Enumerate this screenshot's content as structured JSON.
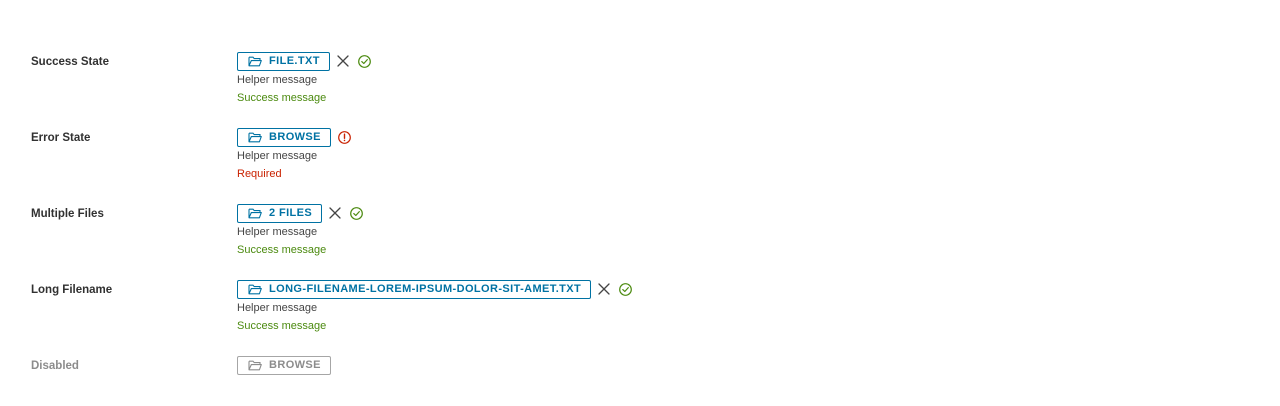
{
  "colors": {
    "primary": "#0072a3",
    "success": "#4b8a0f",
    "error": "#c92100",
    "disabled": "#8c8c8c",
    "text": "#313131"
  },
  "rows": [
    {
      "label": "Success State",
      "button_label": "FILE.TXT",
      "helper": "Helper message",
      "status_message": "Success message",
      "status": "success",
      "icons": [
        "folder-icon",
        "close-icon",
        "check-circle-icon"
      ]
    },
    {
      "label": "Error State",
      "button_label": "BROWSE",
      "helper": "Helper message",
      "status_message": "Required",
      "status": "error",
      "icons": [
        "folder-icon",
        "exclamation-circle-icon"
      ]
    },
    {
      "label": "Multiple Files",
      "button_label": "2 FILES",
      "helper": "Helper message",
      "status_message": "Success message",
      "status": "success",
      "icons": [
        "folder-icon",
        "close-icon",
        "check-circle-icon"
      ]
    },
    {
      "label": "Long Filename",
      "button_label": "LONG-FILENAME-LOREM-IPSUM-DOLOR-SIT-AMET.TXT",
      "helper": "Helper message",
      "status_message": "Success message",
      "status": "success",
      "icons": [
        "folder-icon",
        "close-icon",
        "check-circle-icon"
      ]
    },
    {
      "label": "Disabled",
      "button_label": "BROWSE",
      "status": "disabled",
      "icons": [
        "folder-icon"
      ]
    }
  ]
}
